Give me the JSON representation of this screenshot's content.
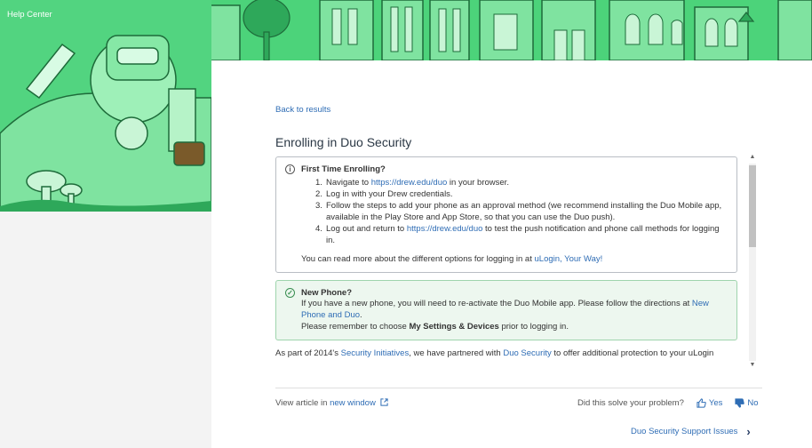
{
  "header": {
    "title": "Help Center"
  },
  "article": {
    "back_label": "Back to results",
    "title": "Enrolling in Duo Security",
    "callout1": {
      "heading": "First Time Enrolling?",
      "steps": [
        {
          "num": "1.",
          "pre": "Navigate to ",
          "link": "https://drew.edu/duo",
          "post": " in your browser."
        },
        {
          "num": "2.",
          "text": "Log in with your Drew credentials."
        },
        {
          "num": "3.",
          "text": "Follow the steps to add your phone as an approval method (we recommend installing the Duo Mobile app, available in the Play Store and App Store, so that you can use the Duo push)."
        },
        {
          "num": "4.",
          "pre": "Log out and return to ",
          "link": "https://drew.edu/duo",
          "post": " to test the push notification and phone call methods for logging in."
        }
      ],
      "more_pre": "You can read more about the different options for logging in at ",
      "more_link": "uLogin, Your Way!"
    },
    "callout2": {
      "heading": "New Phone?",
      "line1_pre": "If you have a new phone, you will need to re-activate the Duo Mobile app. Please follow the directions at ",
      "line1_link": "New Phone and Duo",
      "line1_post": ".",
      "line2_pre": "Please remember to choose ",
      "line2_bold": "My Settings & Devices",
      "line2_post": " prior to logging in."
    },
    "intro": {
      "pre": "As part of 2014's ",
      "link1": "Security Initiatives",
      "mid": ", we have partnered with ",
      "link2": "Duo Security",
      "post": " to offer additional protection to your uLogin"
    }
  },
  "footer": {
    "view_pre": "View article in ",
    "view_link": "new window",
    "feedback_question": "Did this solve your problem?",
    "yes_label": "Yes",
    "no_label": "No",
    "related_label": "Duo Security Support Issues"
  },
  "colors": {
    "banner_green": "#4cd37a",
    "link": "#2f6db5",
    "callout_green_bg": "#edf7ef"
  },
  "icons": [
    "info-icon",
    "check-circle-icon",
    "external-link-icon",
    "thumbs-up-icon",
    "thumbs-down-icon",
    "chevron-right-icon"
  ]
}
